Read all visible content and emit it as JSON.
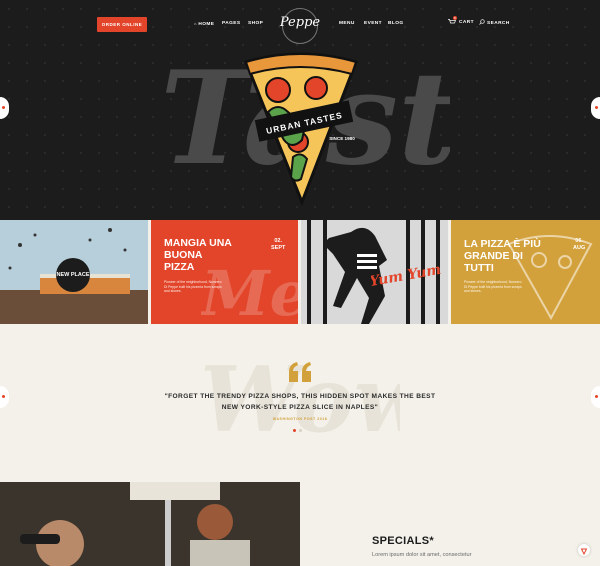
{
  "header": {
    "order_button": "ORDER ONLINE",
    "nav_left": [
      "HOME",
      "PAGES",
      "SHOP"
    ],
    "nav_right": [
      "MENU",
      "EVENT",
      "BLOG"
    ],
    "logo_text": "Peppe",
    "cart_label": "CART",
    "cart_count": "0",
    "search_label": "SEARCH"
  },
  "hero": {
    "script_word": "Taste",
    "banner_text": "URBAN TASTES",
    "since_text": "SINCE 1980",
    "arrow_left": "PREV",
    "arrow_right": "NEXT"
  },
  "cards": [
    {
      "badge": "NEW PLACE"
    },
    {
      "title": "MANGIA UNA BUONA PIZZA",
      "date_day": "02.",
      "date_month": "SEPT",
      "script": "Me",
      "desc": "Pioneer of the neighborhood, Nunzero Di Peppe built his pizzeria from scraps and stones."
    },
    {
      "script": "Yum Yum Yum"
    },
    {
      "title": "LA PIZZA È PIÙ GRANDE DI TUTTI",
      "date_day": "06.",
      "date_month": "AUG",
      "desc": "Pioneer of the neighborhood, Nunzero Di Peppe built his pizzeria from scraps and stones."
    }
  ],
  "quote": {
    "script_word": "Wow",
    "text": "\"FORGET THE TRENDY PIZZA SHOPS, THIS HIDDEN SPOT MAKES THE BEST NEW YORK-STYLE PIZZA SLICE IN NAPLES\"",
    "source": "WASHINGTON POST 2018",
    "arrow_left": "PREV",
    "arrow_right": "NEXT"
  },
  "specials": {
    "title": "SPECIALS*",
    "subtitle": "Lorem ipsum dolor sit amet, consectetur"
  },
  "colors": {
    "accent": "#e2452a",
    "gold": "#d3a13b",
    "dark": "#1c1c1c",
    "cream": "#f3f1ea"
  }
}
